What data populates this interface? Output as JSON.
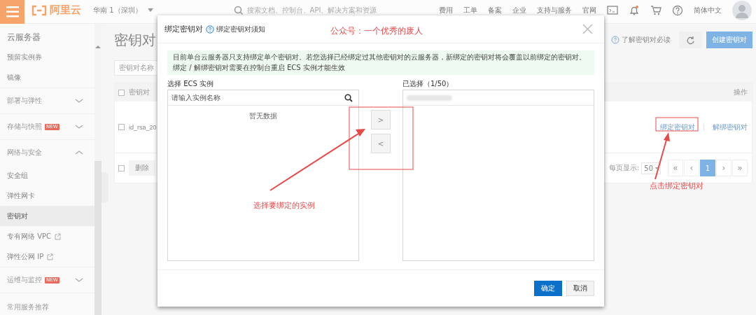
{
  "header": {
    "logo": "阿里云",
    "region": "华南 1（深圳）",
    "search_placeholder": "搜索文档、控制台、API、解决方案和资源",
    "nav": [
      "费用",
      "工单",
      "备案",
      "企业",
      "支持与服务",
      "官网"
    ],
    "language": "简体中文"
  },
  "sidebar": {
    "title": "云服务器",
    "items": [
      {
        "label": "预留实例券",
        "kind": "link",
        "selected": false
      },
      {
        "label": "镜像",
        "kind": "link",
        "selected": false
      },
      {
        "label": "部署与弹性",
        "kind": "group",
        "expanded": false,
        "selected": false
      },
      {
        "label": "存储与快照",
        "kind": "group",
        "badge": "NEW",
        "expanded": false,
        "selected": false
      },
      {
        "label": "网络与安全",
        "kind": "group",
        "expanded": true,
        "selected": false
      },
      {
        "label": "安全组",
        "kind": "link",
        "selected": false
      },
      {
        "label": "弹性网卡",
        "kind": "link",
        "selected": false
      },
      {
        "label": "密钥对",
        "kind": "link",
        "selected": true
      },
      {
        "label": "专有网络 VPC",
        "kind": "external",
        "selected": false
      },
      {
        "label": "弹性公网 IP",
        "kind": "external",
        "selected": false
      },
      {
        "label": "运维与监控",
        "kind": "group",
        "badge": "NEW",
        "expanded": false,
        "selected": false
      },
      {
        "label": "常用服务推荐",
        "kind": "heading",
        "selected": false
      }
    ]
  },
  "page": {
    "title": "密钥对",
    "help_link": "了解密钥对必读",
    "create_button": "创建密钥对",
    "filter": "密钥对名称",
    "table": {
      "columns": [
        "密钥对",
        "操作"
      ],
      "header_checked": false,
      "rows": [
        {
          "checked": false,
          "name": "id_rsa_20",
          "actions": [
            "绑定密钥对",
            "解绑密钥对"
          ]
        }
      ]
    },
    "footer_checked": false,
    "delete_button": "删除",
    "page_size_label": "每页显示:",
    "page_size": "50",
    "pagination": [
      {
        "label": "«",
        "selected": false
      },
      {
        "label": "‹",
        "selected": false
      },
      {
        "label": "1",
        "selected": true
      },
      {
        "label": "›",
        "selected": false
      },
      {
        "label": "»",
        "selected": false
      }
    ]
  },
  "modal": {
    "title": "绑定密钥对",
    "help_link": "绑定密钥对须知",
    "notice": [
      "目前单台云服务器只支持绑定单个密钥对。若您选择已经绑定过其他密钥对的云服务器，新绑定的密钥对将会覆盖以前绑定的密钥对。",
      "绑定 / 解绑密钥对需要在控制台重启 ECS 实例才能生效"
    ],
    "left_label": "选择 ECS 实例",
    "search_placeholder": "请输入实例名称",
    "empty_text": "暂无数据",
    "right_label": "已选择（1/50）",
    "selected_items": [
      {
        "kind": "redacted"
      }
    ],
    "transfer_buttons": [
      ">",
      "<"
    ],
    "ok_button": "确定",
    "cancel_button": "取消"
  },
  "annotations": [
    {
      "text": "公众号：一个优秀的废人",
      "kind": "note"
    },
    {
      "text": "选择要绑定的实例",
      "kind": "callout"
    },
    {
      "text": "点击绑定密钥对",
      "kind": "callout"
    }
  ]
}
